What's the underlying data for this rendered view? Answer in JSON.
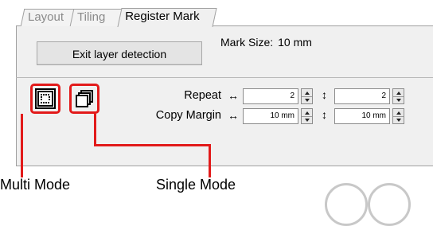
{
  "tabs": [
    {
      "label": "Layout",
      "active": false
    },
    {
      "label": "Tiling",
      "active": false
    },
    {
      "label": "Register Mark",
      "active": true
    }
  ],
  "exit_button": {
    "label": "Exit layer detection"
  },
  "mark_size": {
    "label": "Mark Size:",
    "value": "10 mm"
  },
  "repeat": {
    "label": "Repeat",
    "arrow_h": "↔",
    "arrow_v": "↕",
    "value_h": "2",
    "value_v": "2"
  },
  "copy_margin": {
    "label": "Copy Margin",
    "arrow_h": "↔",
    "arrow_v": "↕",
    "value_h": "10 mm",
    "value_v": "10 mm"
  },
  "callouts": {
    "multi": "Multi Mode",
    "single": "Single Mode"
  },
  "colors": {
    "highlight": "#e21a1a",
    "panel_bg": "#f0f0f0"
  },
  "icons": {
    "multi": "multi-mark-grid-icon",
    "single": "single-mark-pages-icon"
  }
}
